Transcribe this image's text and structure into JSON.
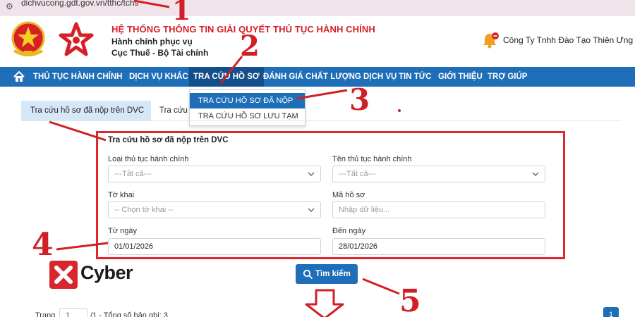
{
  "browser": {
    "url": "dichvucong.gdt.gov.vn/tthc/tchs"
  },
  "header": {
    "system_title": "HỆ THỐNG THÔNG TIN GIẢI QUYẾT THỦ TỤC HÀNH CHÍNH",
    "subtitle_1": "Hành chính phục vụ",
    "subtitle_2": "Cục Thuế - Bộ Tài chính",
    "company": "Công Ty Tnhh Đào Tạo Thiên Ưng"
  },
  "nav": {
    "items": [
      {
        "label": "THỦ TỤC HÀNH CHÍNH"
      },
      {
        "label": "DỊCH VỤ KHÁC"
      },
      {
        "label": "TRA CỨU HỒ SƠ"
      },
      {
        "label": "ĐÁNH GIÁ CHẤT LƯỢNG DỊCH VỤ"
      },
      {
        "label": "TIN TỨC"
      },
      {
        "label": "GIỚI THIỆU"
      },
      {
        "label": "TRỢ GIÚP"
      }
    ]
  },
  "dropdown": {
    "items": [
      {
        "label": "TRA CỨU HỒ SƠ ĐÃ NỘP"
      },
      {
        "label": "TRA CỨU HỒ SƠ LƯU TẠM"
      }
    ]
  },
  "tabs": [
    {
      "label": "Tra cứu hồ sơ đã nộp trên DVC"
    },
    {
      "label": "Tra cứu"
    }
  ],
  "form": {
    "title": "Tra cứu hồ sơ đã nộp trên DVC",
    "loai_label": "Loại thủ tục hành chính",
    "loai_value": "---Tất cả---",
    "ten_label": "Tên thủ tục hành chính",
    "ten_value": "---Tất cả---",
    "tokhai_label": "Tờ khai",
    "tokhai_value": "-- Chọn tờ khai --",
    "maso_label": "Mã hồ sơ",
    "maso_placeholder": "Nhập dữ liệu...",
    "tungay_label": "Từ ngày",
    "tungay_value": "01/01/2026",
    "denngay_label": "Đến ngày",
    "denngay_value": "28/01/2026"
  },
  "search_button": "Tìm kiếm",
  "cyber_logo_text": "Cyber",
  "pagination": {
    "page_label": "Trang",
    "page_value": "1",
    "total_text": "/1 - Tổng số bản ghi: 3",
    "current_page": "1"
  },
  "annotations": [
    "1",
    "2",
    "3",
    "4",
    "5"
  ],
  "colors": {
    "primary": "#1e6fb8",
    "annotation_red": "#d01f25",
    "title_red": "#d71f27"
  }
}
